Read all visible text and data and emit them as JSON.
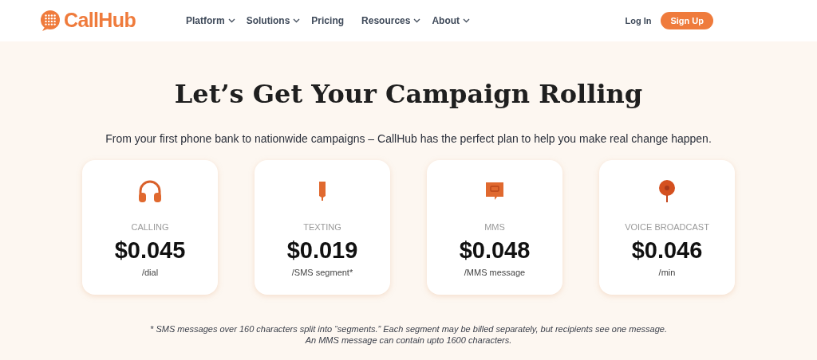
{
  "header": {
    "logo": "CallHub",
    "nav": [
      {
        "label": "Platform",
        "has_menu": true
      },
      {
        "label": "Solutions",
        "has_menu": true
      },
      {
        "label": "Pricing",
        "has_menu": false
      },
      {
        "label": "Resources",
        "has_menu": true
      },
      {
        "label": "About",
        "has_menu": true
      }
    ],
    "login": "Log In",
    "signup": "Sign Up"
  },
  "hero": {
    "title": "Let’s Get Your Campaign Rolling",
    "subtitle": "From your first phone bank to nationwide campaigns – CallHub has the perfect plan to help you make real change happen."
  },
  "plans": [
    {
      "kind": "headphones",
      "name": "CALLING",
      "price": "$0.045",
      "unit": "/dial"
    },
    {
      "kind": "texting",
      "name": "TEXTING",
      "price": "$0.019",
      "unit": "/SMS segment*"
    },
    {
      "kind": "mms",
      "name": "MMS",
      "price": "$0.048",
      "unit": "/MMS message"
    },
    {
      "kind": "broadcast",
      "name": "VOICE BROADCAST",
      "price": "$0.046",
      "unit": "/min"
    }
  ],
  "footnote": "* SMS messages over 160 characters split into “segments.” Each segment may be billed separately, but recipients see one message. An MMS message can contain upto 1600 characters."
}
